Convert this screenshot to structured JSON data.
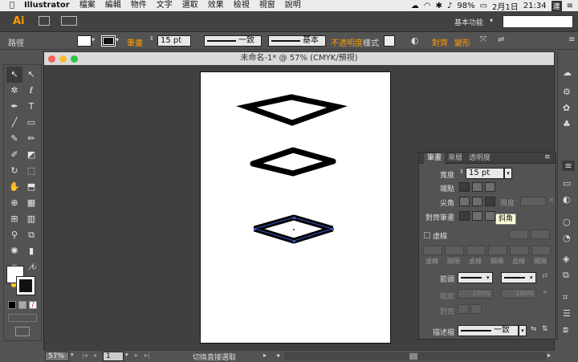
{
  "menubar": {
    "app": "Illustrator",
    "items": [
      "檔案",
      "編輯",
      "物件",
      "文字",
      "選取",
      "效果",
      "檢視",
      "視窗",
      "說明"
    ],
    "battery": "98%",
    "date": "2月1日",
    "time": "21:34",
    "user": "連"
  },
  "appbar": {
    "logo": "Ai",
    "workspace": "基本功能"
  },
  "control": {
    "path_label": "路徑",
    "stroke_label": "筆畫",
    "stroke_value": "15 pt",
    "uniform": "一致",
    "basic": "基本",
    "opacity_label": "不透明度",
    "style_label": "樣式",
    "align_label": "對齊",
    "shape_label": "變形"
  },
  "document": {
    "title": "未命名-1* @ 57% (CMYK/預視)"
  },
  "stroke_panel": {
    "tabs": [
      "筆畫",
      "漸層",
      "透明度"
    ],
    "weight_label": "寬度",
    "weight_value": "15 pt",
    "cap_label": "端點",
    "corner_label": "尖角",
    "limit_label": "限度",
    "align_label": "對齊筆畫",
    "dashed_label": "虛線",
    "dash_labels": [
      "虛線",
      "間隔",
      "虛線",
      "間隔",
      "虛線",
      "間隔"
    ],
    "arrow_label": "箭頭",
    "scale_label": "縮放",
    "scale_values": [
      "100%",
      "100%"
    ],
    "align2_label": "對齊",
    "profile_label": "描述檔",
    "profile_value": "一致"
  },
  "tooltip": "斜角",
  "statusbar": {
    "zoom": "57%",
    "page": "1",
    "status": "切換直接選取"
  },
  "colors": {
    "accent": "#ff9a00",
    "selection": "#3c58c8"
  }
}
